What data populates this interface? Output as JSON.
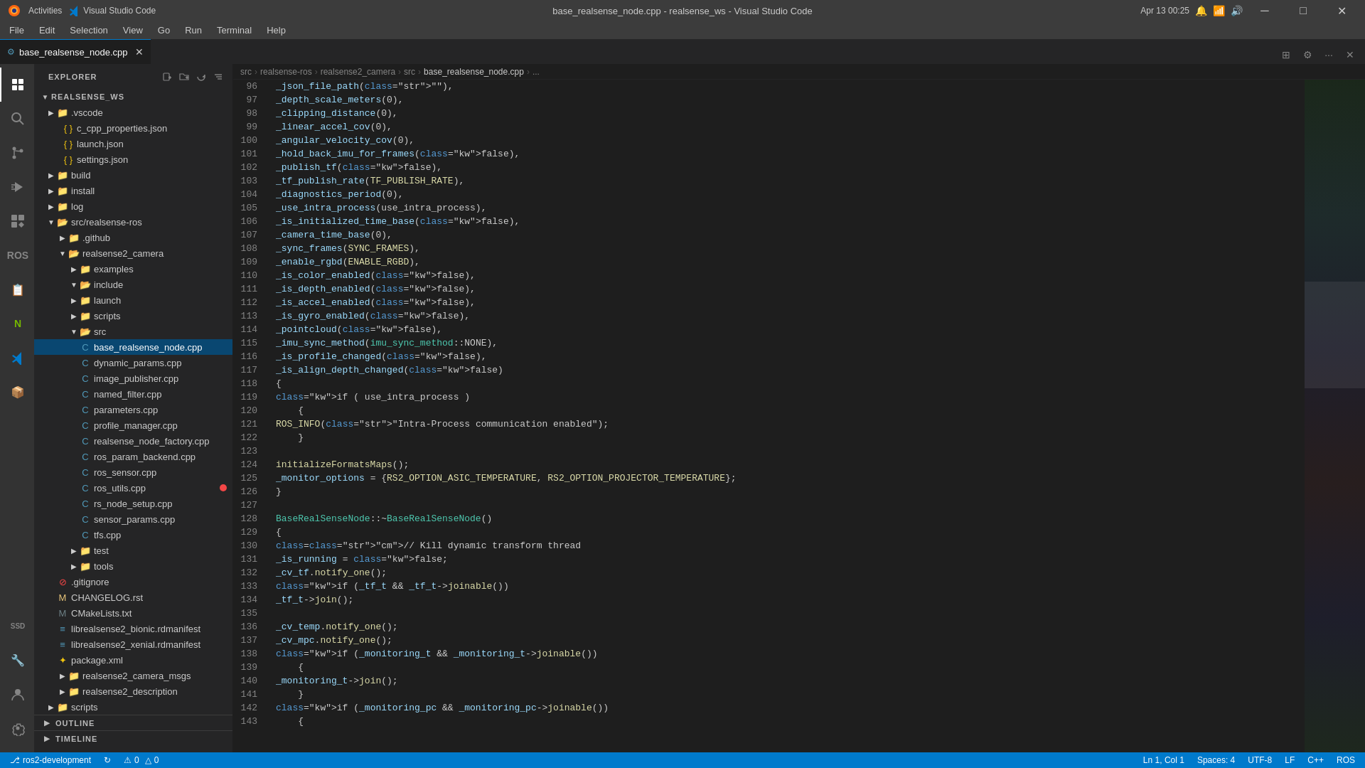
{
  "titleBar": {
    "left": {
      "activities": "Activities",
      "appName": "Visual Studio Code"
    },
    "center": "base_realsense_node.cpp - realsense_ws - Visual Studio Code",
    "right": {
      "date": "Apr 13  00:25"
    },
    "windowControls": {
      "minimize": "─",
      "maximize": "□",
      "close": "✕"
    }
  },
  "menuBar": {
    "items": [
      "File",
      "Edit",
      "Selection",
      "View",
      "Go",
      "Run",
      "Terminal",
      "Help"
    ]
  },
  "tabBar": {
    "tabs": [
      {
        "label": "base_realsense_node.cpp",
        "active": true,
        "modified": false
      }
    ]
  },
  "sidebar": {
    "title": "Explorer",
    "icons": [
      "new-file",
      "new-folder",
      "refresh",
      "collapse"
    ],
    "rootLabel": "REALSENSE_WS",
    "tree": [
      {
        "indent": 0,
        "type": "folder",
        "open": false,
        "label": ".vscode"
      },
      {
        "indent": 1,
        "type": "file-json",
        "label": "c_cpp_properties.json"
      },
      {
        "indent": 1,
        "type": "file-json",
        "label": "launch.json"
      },
      {
        "indent": 1,
        "type": "file-json",
        "label": "settings.json"
      },
      {
        "indent": 0,
        "type": "folder",
        "open": false,
        "label": "build"
      },
      {
        "indent": 0,
        "type": "folder",
        "open": false,
        "label": "install"
      },
      {
        "indent": 0,
        "type": "folder",
        "open": false,
        "label": "log"
      },
      {
        "indent": 0,
        "type": "folder",
        "open": true,
        "label": "src/realsense-ros"
      },
      {
        "indent": 1,
        "type": "folder",
        "open": false,
        "label": ".github"
      },
      {
        "indent": 1,
        "type": "folder",
        "open": true,
        "label": "realsense2_camera"
      },
      {
        "indent": 2,
        "type": "folder",
        "open": false,
        "label": "examples"
      },
      {
        "indent": 2,
        "type": "folder",
        "open": true,
        "label": "include"
      },
      {
        "indent": 2,
        "type": "folder",
        "open": false,
        "label": "launch"
      },
      {
        "indent": 2,
        "type": "folder",
        "open": false,
        "label": "scripts"
      },
      {
        "indent": 2,
        "type": "folder",
        "open": true,
        "label": "src"
      },
      {
        "indent": 3,
        "type": "file-cpp-active",
        "label": "base_realsense_node.cpp",
        "active": true
      },
      {
        "indent": 3,
        "type": "file-cpp",
        "label": "dynamic_params.cpp"
      },
      {
        "indent": 3,
        "type": "file-cpp",
        "label": "image_publisher.cpp"
      },
      {
        "indent": 3,
        "type": "file-cpp",
        "label": "named_filter.cpp"
      },
      {
        "indent": 3,
        "type": "file-cpp",
        "label": "parameters.cpp"
      },
      {
        "indent": 3,
        "type": "file-cpp",
        "label": "profile_manager.cpp"
      },
      {
        "indent": 3,
        "type": "file-cpp",
        "label": "realsense_node_factory.cpp"
      },
      {
        "indent": 3,
        "type": "file-cpp",
        "label": "ros_param_backend.cpp"
      },
      {
        "indent": 3,
        "type": "file-cpp",
        "label": "ros_sensor.cpp"
      },
      {
        "indent": 3,
        "type": "file-cpp",
        "label": "ros_utils.cpp",
        "breakpoint": true
      },
      {
        "indent": 3,
        "type": "file-cpp",
        "label": "rs_node_setup.cpp"
      },
      {
        "indent": 3,
        "type": "file-cpp",
        "label": "sensor_params.cpp"
      },
      {
        "indent": 3,
        "type": "file-cpp",
        "label": "tfs.cpp"
      },
      {
        "indent": 2,
        "type": "folder",
        "open": false,
        "label": "test"
      },
      {
        "indent": 2,
        "type": "folder",
        "open": false,
        "label": "tools"
      },
      {
        "indent": 1,
        "type": "file-git",
        "label": ".gitignore"
      },
      {
        "indent": 1,
        "type": "file",
        "label": "CHANGELOG.rst"
      },
      {
        "indent": 1,
        "type": "file",
        "label": "CMakeLists.txt"
      },
      {
        "indent": 1,
        "type": "file-rdmanifest",
        "label": "librealsense2_bionic.rdmanifest"
      },
      {
        "indent": 1,
        "type": "file-rdmanifest",
        "label": "librealsense2_xenial.rdmanifest"
      },
      {
        "indent": 1,
        "type": "file-xml",
        "label": "package.xml"
      },
      {
        "indent": 1,
        "type": "folder",
        "open": false,
        "label": "realsense2_camera_msgs"
      },
      {
        "indent": 1,
        "type": "folder",
        "open": false,
        "label": "realsense2_description"
      },
      {
        "indent": 0,
        "type": "folder",
        "open": false,
        "label": "scripts"
      }
    ],
    "outline": "OUTLINE",
    "timeline": "TIMELINE"
  },
  "breadcrumb": {
    "items": [
      "src",
      "realsense-ros",
      "realsense2_camera",
      "src",
      "base_realsense_node.cpp",
      "..."
    ]
  },
  "editor": {
    "filename": "base_realsense_node.cpp",
    "lines": [
      {
        "num": 96,
        "code": "    _json_file_path(\"\"),"
      },
      {
        "num": 97,
        "code": "    _depth_scale_meters(0),"
      },
      {
        "num": 98,
        "code": "    _clipping_distance(0),"
      },
      {
        "num": 99,
        "code": "    _linear_accel_cov(0),"
      },
      {
        "num": 100,
        "code": "    _angular_velocity_cov(0),"
      },
      {
        "num": 101,
        "code": "    _hold_back_imu_for_frames(false),"
      },
      {
        "num": 102,
        "code": "    _publish_tf(false),"
      },
      {
        "num": 103,
        "code": "    _tf_publish_rate(TF_PUBLISH_RATE),"
      },
      {
        "num": 104,
        "code": "    _diagnostics_period(0),"
      },
      {
        "num": 105,
        "code": "    _use_intra_process(use_intra_process),"
      },
      {
        "num": 106,
        "code": "    _is_initialized_time_base(false),"
      },
      {
        "num": 107,
        "code": "    _camera_time_base(0),"
      },
      {
        "num": 108,
        "code": "    _sync_frames(SYNC_FRAMES),"
      },
      {
        "num": 109,
        "code": "    _enable_rgbd(ENABLE_RGBD),"
      },
      {
        "num": 110,
        "code": "    _is_color_enabled(false),"
      },
      {
        "num": 111,
        "code": "    _is_depth_enabled(false),"
      },
      {
        "num": 112,
        "code": "    _is_accel_enabled(false),"
      },
      {
        "num": 113,
        "code": "    _is_gyro_enabled(false),"
      },
      {
        "num": 114,
        "code": "    _pointcloud(false),"
      },
      {
        "num": 115,
        "code": "    _imu_sync_method(imu_sync_method::NONE),"
      },
      {
        "num": 116,
        "code": "    _is_profile_changed(false),"
      },
      {
        "num": 117,
        "code": "    _is_align_depth_changed(false)"
      },
      {
        "num": 118,
        "code": "{"
      },
      {
        "num": 119,
        "code": "    if ( use_intra_process )"
      },
      {
        "num": 120,
        "code": "    {"
      },
      {
        "num": 121,
        "code": "        ROS_INFO(\"Intra-Process communication enabled\");"
      },
      {
        "num": 122,
        "code": "    }"
      },
      {
        "num": 123,
        "code": ""
      },
      {
        "num": 124,
        "code": "    initializeFormatsMaps();"
      },
      {
        "num": 125,
        "code": "    _monitor_options = {RS2_OPTION_ASIC_TEMPERATURE, RS2_OPTION_PROJECTOR_TEMPERATURE};"
      },
      {
        "num": 126,
        "code": "}"
      },
      {
        "num": 127,
        "code": ""
      },
      {
        "num": 128,
        "code": "BaseRealSenseNode::~BaseRealSenseNode()"
      },
      {
        "num": 129,
        "code": "{"
      },
      {
        "num": 130,
        "code": "    // Kill dynamic transform thread"
      },
      {
        "num": 131,
        "code": "    _is_running = false;"
      },
      {
        "num": 132,
        "code": "    _cv_tf.notify_one();"
      },
      {
        "num": 133,
        "code": "    if (_tf_t && _tf_t->joinable())"
      },
      {
        "num": 134,
        "code": "        _tf_t->join();"
      },
      {
        "num": 135,
        "code": ""
      },
      {
        "num": 136,
        "code": "    _cv_temp.notify_one();"
      },
      {
        "num": 137,
        "code": "    _cv_mpc.notify_one();"
      },
      {
        "num": 138,
        "code": "    if (_monitoring_t && _monitoring_t->joinable())"
      },
      {
        "num": 139,
        "code": "    {"
      },
      {
        "num": 140,
        "code": "        _monitoring_t->join();"
      },
      {
        "num": 141,
        "code": "    }"
      },
      {
        "num": 142,
        "code": "    if (_monitoring_pc && _monitoring_pc->joinable())"
      },
      {
        "num": 143,
        "code": "    {"
      }
    ]
  },
  "statusBar": {
    "left": {
      "branch": "ros2-development",
      "sync": "↻",
      "errors": "0",
      "warnings": "0"
    },
    "right": {
      "position": "Ln 1, Col 1",
      "spaces": "Spaces: 4",
      "encoding": "UTF-8",
      "eol": "LF",
      "language": "C++",
      "ros": "ROS"
    }
  }
}
